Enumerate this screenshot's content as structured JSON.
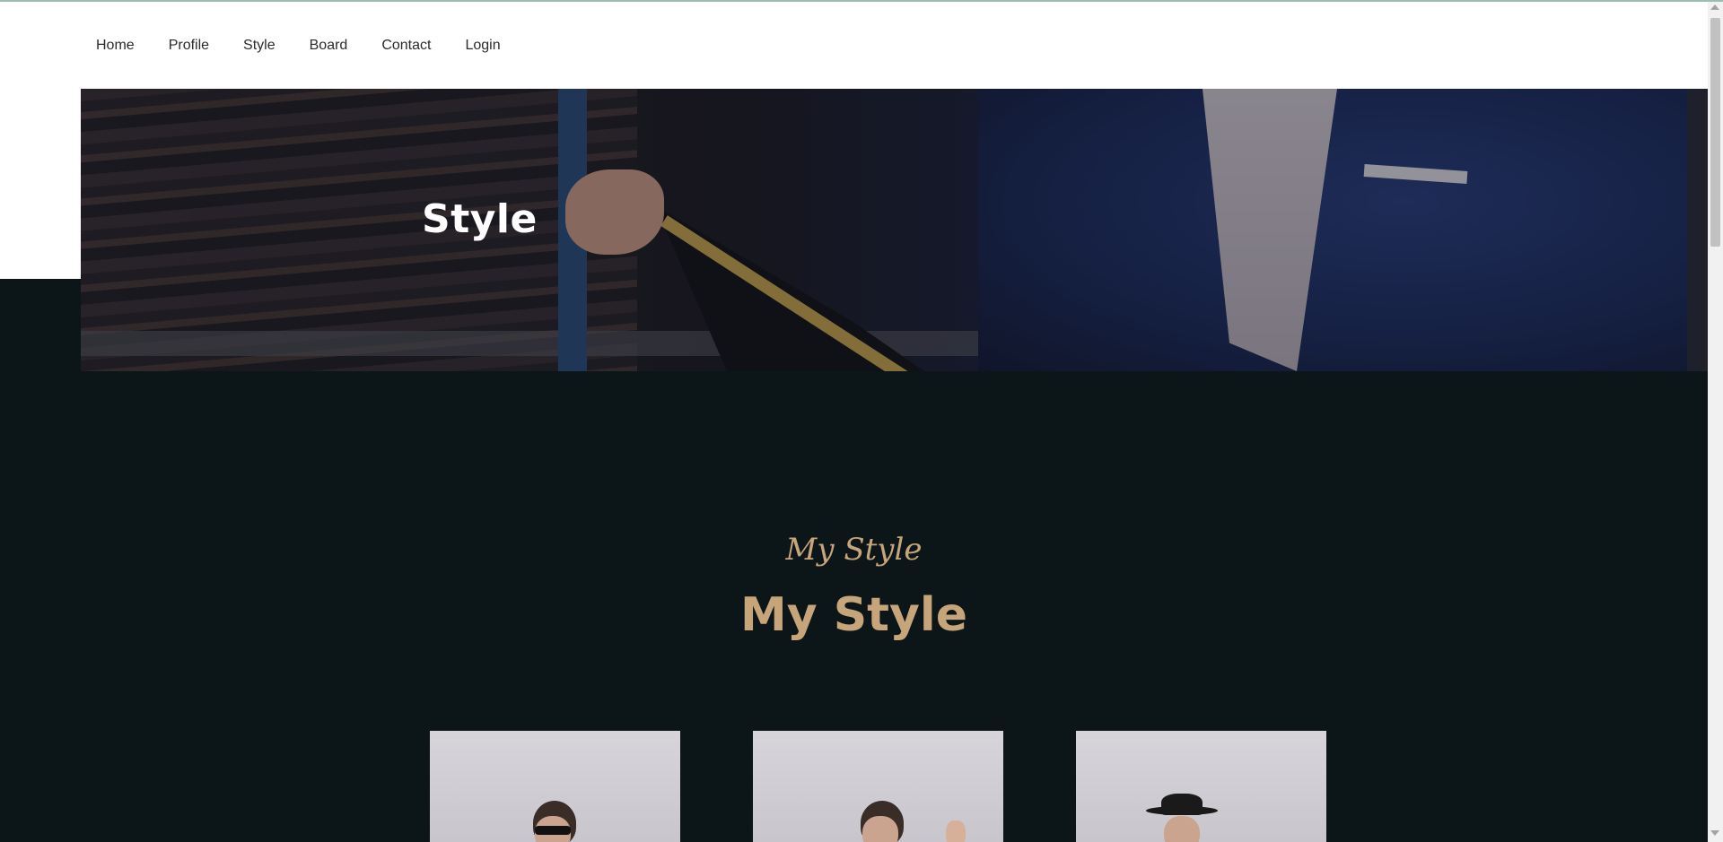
{
  "nav": {
    "items": [
      {
        "label": "Home"
      },
      {
        "label": "Profile"
      },
      {
        "label": "Style"
      },
      {
        "label": "Board"
      },
      {
        "label": "Contact"
      },
      {
        "label": "Login"
      }
    ]
  },
  "hero": {
    "title": "Style"
  },
  "section": {
    "script_title": "My Style",
    "title": "My Style"
  },
  "colors": {
    "accent": "#c6a57a",
    "background": "#0c1518"
  }
}
